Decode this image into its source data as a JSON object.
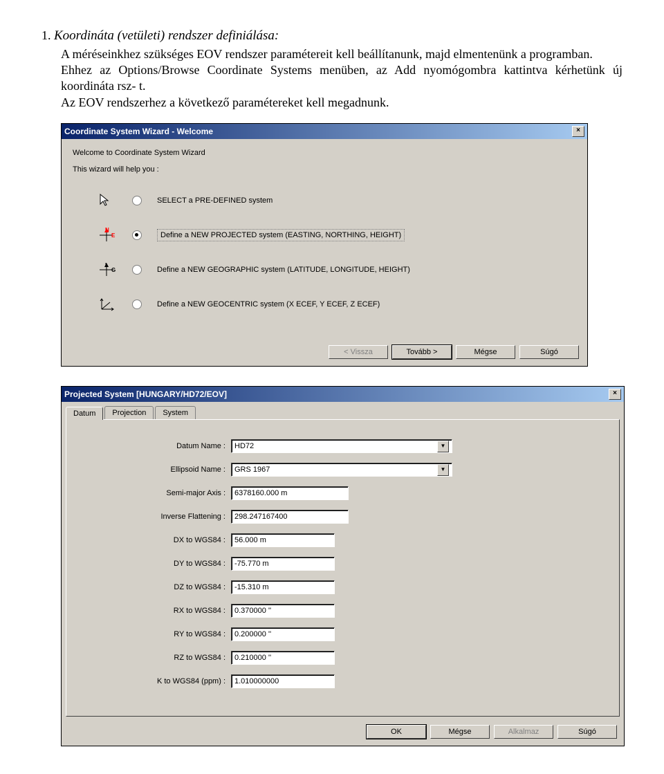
{
  "doc": {
    "number": "1.",
    "title": "Koordináta (vetületi) rendszer definiálása:",
    "p1": "A méréseinkhez szükséges EOV rendszer paramétereit kell beállítanunk, majd elmentenünk a programban.",
    "p2": "Ehhez az Options/Browse Coordinate Systems menüben, az Add nyomógombra kattintva kérhetünk új koordináta rsz- t.",
    "p3": "Az EOV rendszerhez a következő paramétereket kell megadnunk."
  },
  "wizard": {
    "title": "Coordinate System Wizard - Welcome",
    "welcome": "Welcome to Coordinate System Wizard",
    "help": "This wizard will help you :",
    "opts": {
      "predefined": "SELECT a PRE-DEFINED system",
      "projected": "Define a NEW PROJECTED system (EASTING, NORTHING, HEIGHT)",
      "geographic": "Define a NEW GEOGRAPHIC system (LATITUDE, LONGITUDE, HEIGHT)",
      "geocentric": "Define a NEW GEOCENTRIC system (X ECEF, Y ECEF, Z ECEF)"
    },
    "buttons": {
      "back": "< Vissza",
      "next": "Tovább >",
      "cancel": "Mégse",
      "help": "Súgó"
    }
  },
  "proj": {
    "title": "Projected System [HUNGARY/HD72/EOV]",
    "tabs": {
      "datum": "Datum",
      "projection": "Projection",
      "system": "System"
    },
    "labels": {
      "datum_name": "Datum Name :",
      "ellipsoid": "Ellipsoid Name :",
      "semimajor": "Semi-major Axis :",
      "invflat": "Inverse Flattening :",
      "dx": "DX to WGS84 :",
      "dy": "DY to WGS84 :",
      "dz": "DZ to WGS84 :",
      "rx": "RX to WGS84 :",
      "ry": "RY to WGS84 :",
      "rz": "RZ to WGS84 :",
      "k": "K to WGS84 (ppm) :"
    },
    "values": {
      "datum_name": "HD72",
      "ellipsoid": "GRS 1967",
      "semimajor": "6378160.000 m",
      "invflat": "298.247167400",
      "dx": "56.000 m",
      "dy": "-75.770 m",
      "dz": "-15.310 m",
      "rx": "0.370000 ''",
      "ry": "0.200000 ''",
      "rz": "0.210000 ''",
      "k": "1.010000000"
    },
    "buttons": {
      "ok": "OK",
      "cancel": "Mégse",
      "apply": "Alkalmaz",
      "help": "Súgó"
    }
  }
}
